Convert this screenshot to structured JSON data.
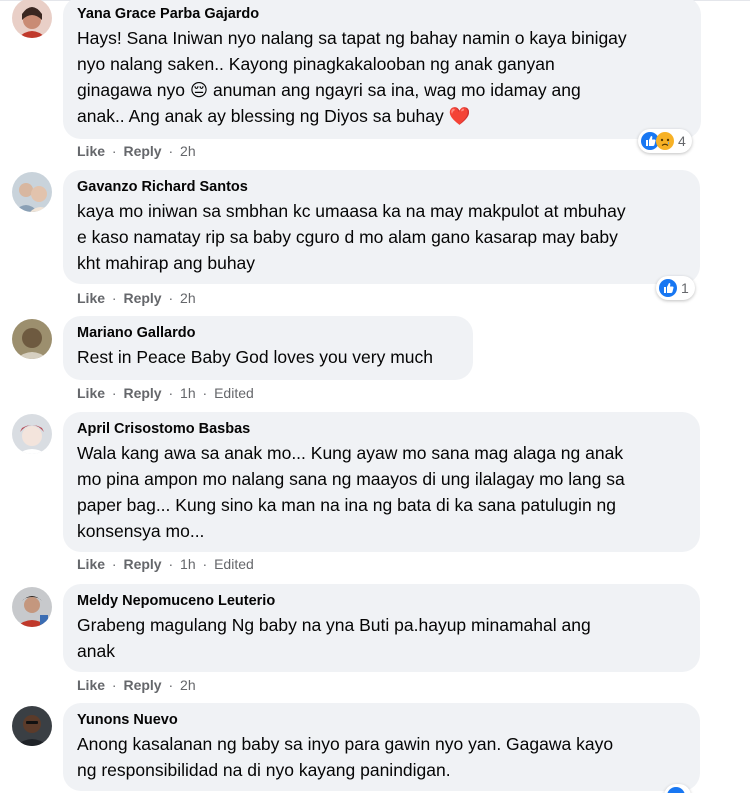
{
  "actions": {
    "like": "Like",
    "reply": "Reply",
    "separator": "·"
  },
  "comments": [
    {
      "author": "Yana Grace Parba Gajardo",
      "lines": [
        "Hays! Sana Iniwan nyo nalang sa tapat ng bahay namin o kaya binigay",
        "nyo nalang saken.. Kayong pinagkakalooban ng anak ganyan",
        "ginagawa nyo 😔 anuman ang ngayri sa ina, wag mo idamay ang",
        "anak.. Ang anak ay blessing ng Diyos sa buhay ❤️"
      ],
      "time": "2h",
      "edited": "",
      "reactions": {
        "icons": [
          "like-reaction-icon",
          "sad-reaction-icon"
        ],
        "count": "4"
      }
    },
    {
      "author": "Gavanzo Richard Santos",
      "lines": [
        "kaya mo iniwan sa smbhan kc umaasa ka na may makpulot at mbuhay",
        "e kaso namatay rip sa baby cguro d mo alam gano kasarap may baby",
        "kht mahirap ang buhay"
      ],
      "time": "2h",
      "edited": "",
      "reactions": {
        "icons": [
          "like-reaction-icon"
        ],
        "count": "1"
      }
    },
    {
      "author": "Mariano Gallardo",
      "lines": [
        "Rest in Peace Baby God loves you very much"
      ],
      "time": "1h",
      "edited": "Edited"
    },
    {
      "author": "April Crisostomo Basbas",
      "lines": [
        "Wala kang awa sa anak mo... Kung ayaw mo sana mag alaga ng anak",
        "mo pina ampon mo nalang sana ng maayos di ung ilalagay mo lang sa",
        "paper bag... Kung sino ka man na ina ng bata di ka sana patulugin ng",
        "konsensya mo..."
      ],
      "time": "1h",
      "edited": "Edited"
    },
    {
      "author": "Meldy Nepomuceno Leuterio",
      "lines": [
        "Grabeng magulang Ng baby na yna Buti pa.hayup minamahal ang",
        "anak"
      ],
      "time": "2h",
      "edited": ""
    },
    {
      "author": "Yunons Nuevo",
      "lines": [
        "Anong kasalanan ng baby sa inyo para gawin nyo yan. Gagawa kayo",
        "ng responsibilidad na di nyo kayang panindigan."
      ],
      "time": "",
      "edited": ""
    }
  ],
  "colors": {
    "bubble": "#f0f2f5",
    "meta_text": "#65676b",
    "like_blue": "#1877f2",
    "sad_yellow": "#f7b125"
  }
}
